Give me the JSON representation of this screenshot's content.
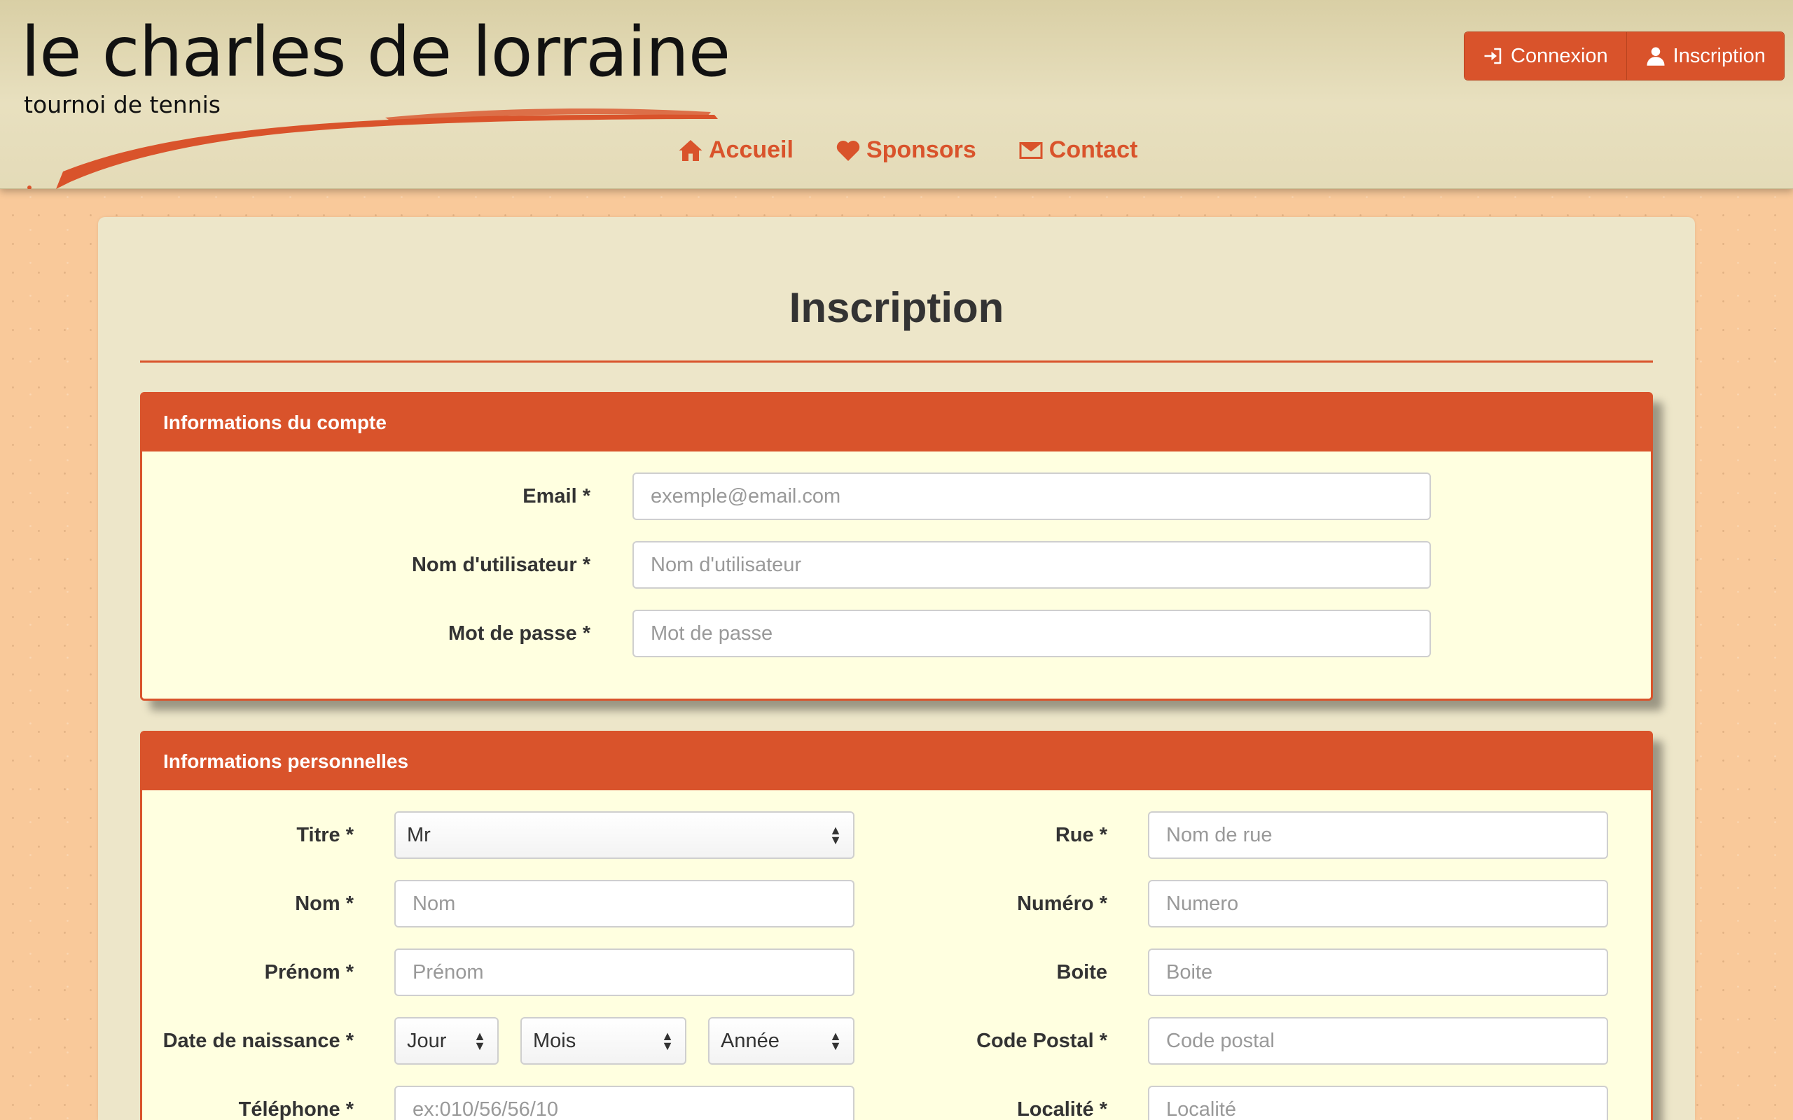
{
  "brand": {
    "title": "le charles de lorraine",
    "subtitle": "tournoi de tennis"
  },
  "auth": {
    "login_label": "Connexion",
    "register_label": "Inscription"
  },
  "nav": {
    "items": [
      {
        "label": "Accueil",
        "icon": "home-icon"
      },
      {
        "label": "Sponsors",
        "icon": "heart-icon"
      },
      {
        "label": "Contact",
        "icon": "envelope-icon"
      }
    ]
  },
  "page": {
    "title": "Inscription"
  },
  "account": {
    "heading": "Informations du compte",
    "email": {
      "label": "Email *",
      "placeholder": "exemple@email.com"
    },
    "username": {
      "label": "Nom d'utilisateur *",
      "placeholder": "Nom d'utilisateur"
    },
    "password": {
      "label": "Mot de passe *",
      "placeholder": "Mot de passe"
    }
  },
  "personal": {
    "heading": "Informations personnelles",
    "titre": {
      "label": "Titre *",
      "value": "Mr"
    },
    "nom": {
      "label": "Nom *",
      "placeholder": "Nom"
    },
    "prenom": {
      "label": "Prénom *",
      "placeholder": "Prénom"
    },
    "birth": {
      "label": "Date de naissance *",
      "day": "Jour",
      "month": "Mois",
      "year": "Année"
    },
    "phone": {
      "label": "Téléphone *",
      "placeholder": "ex:010/56/56/10"
    },
    "rue": {
      "label": "Rue *",
      "placeholder": "Nom de rue"
    },
    "numero": {
      "label": "Numéro *",
      "placeholder": "Numero"
    },
    "boite": {
      "label": "Boite",
      "placeholder": "Boite"
    },
    "code_postal": {
      "label": "Code Postal *",
      "placeholder": "Code postal"
    },
    "localite": {
      "label": "Localité *",
      "placeholder": "Localité"
    }
  },
  "colors": {
    "accent": "#d9532b",
    "panel_bg": "#ffffe0",
    "page_bg": "#f9c99a"
  }
}
